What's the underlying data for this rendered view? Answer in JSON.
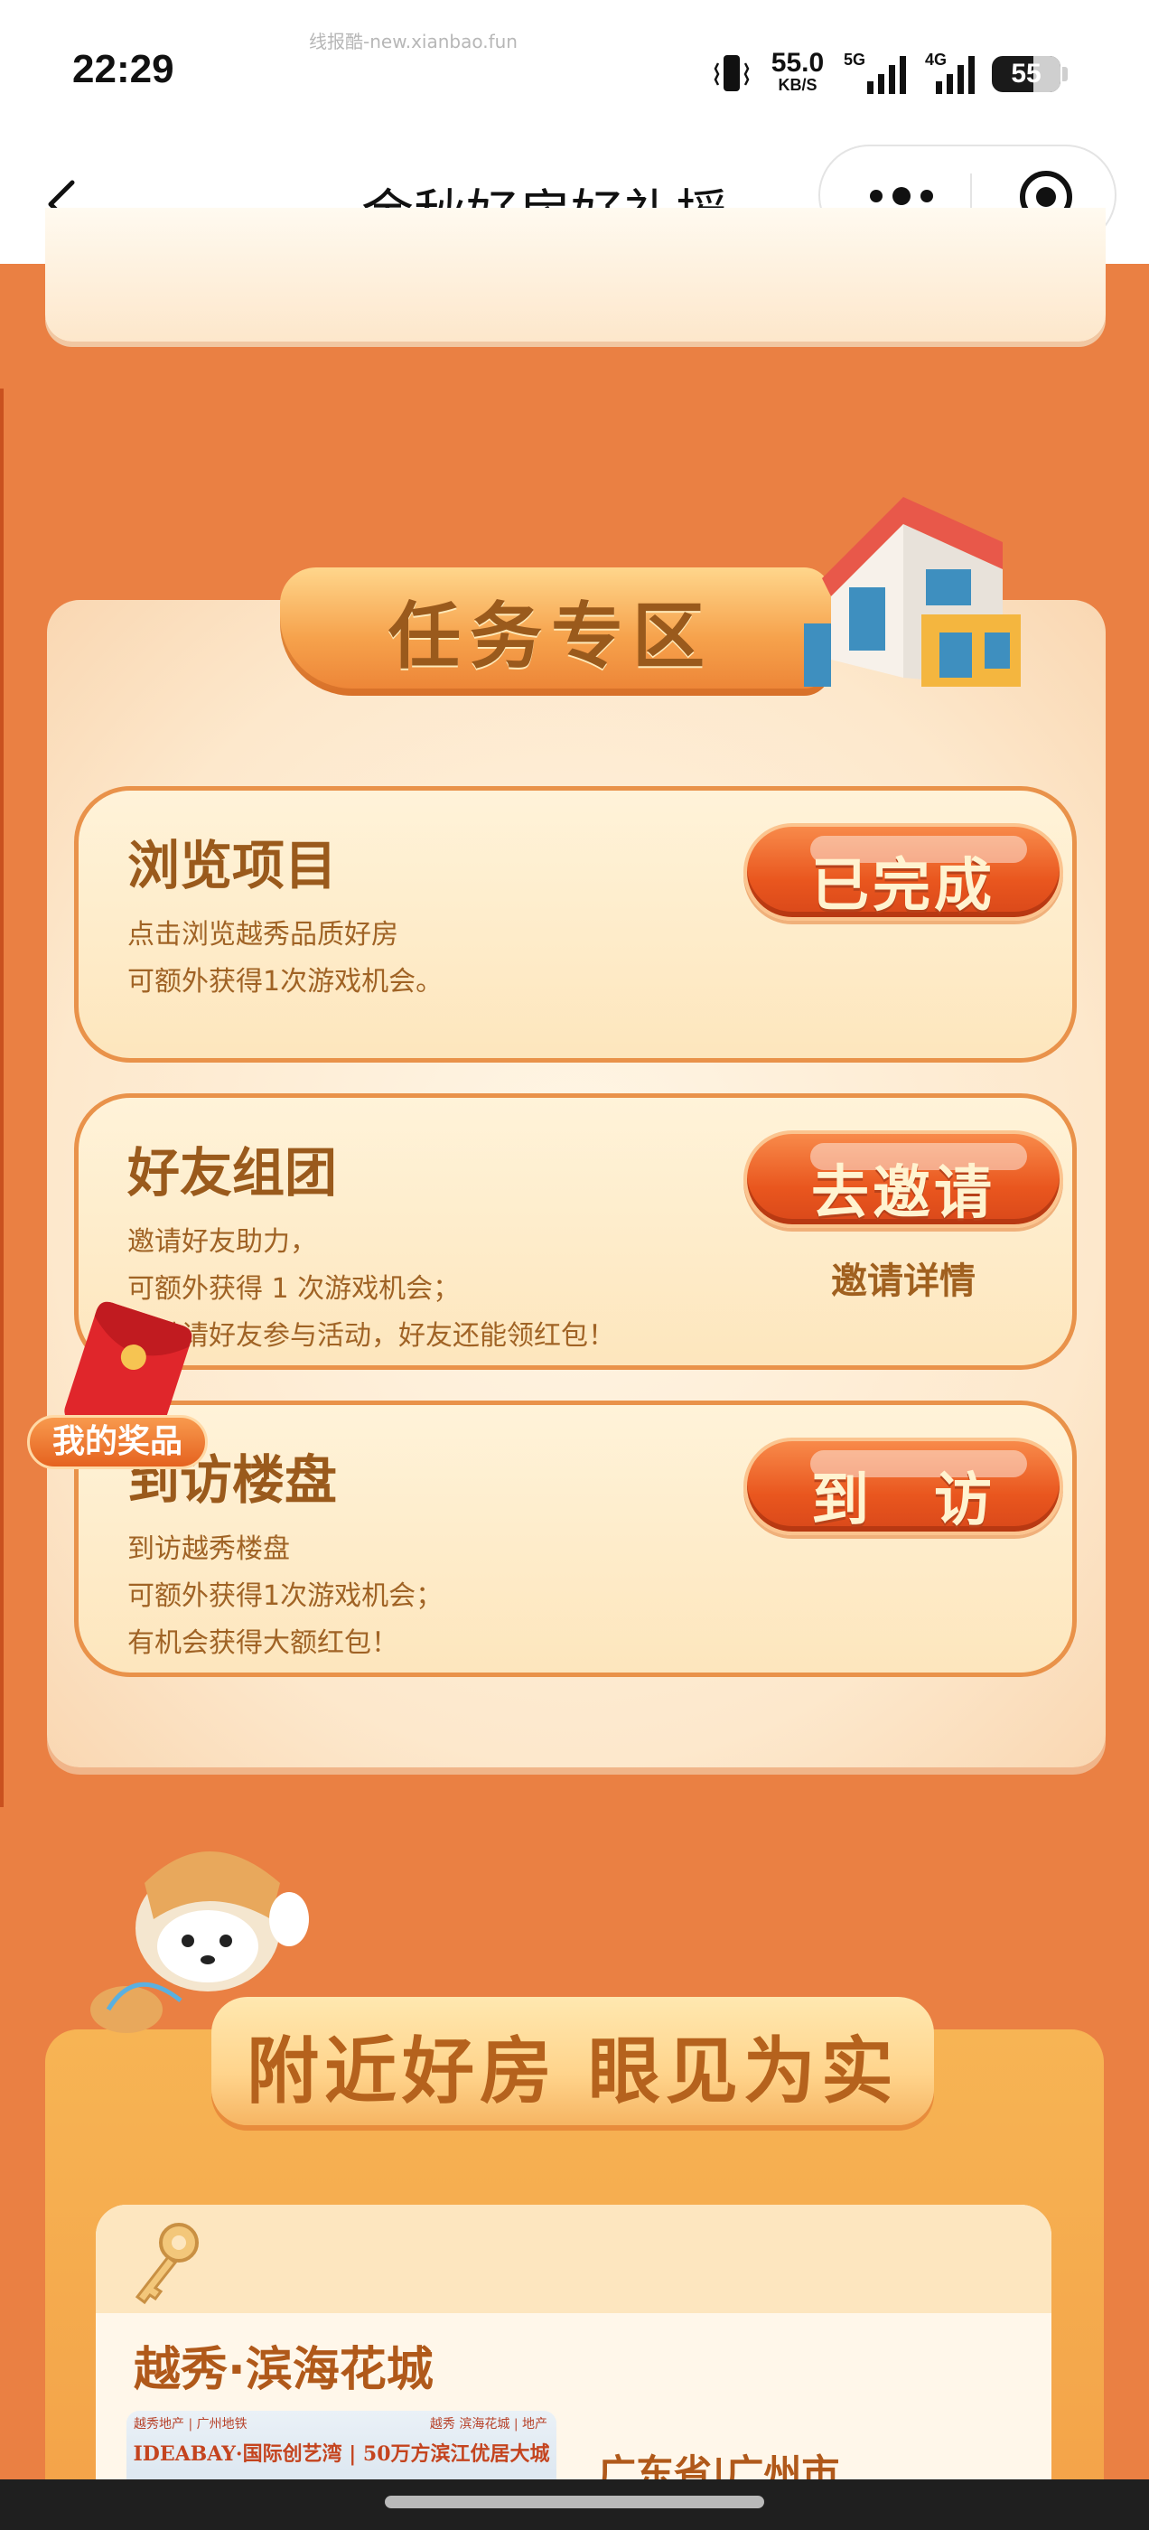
{
  "status_bar": {
    "time": "22:29",
    "watermark": "线报酷-new.xianbao.fun",
    "net_speed_value": "55.0",
    "net_speed_unit": "KB/S",
    "signal_1_tag": "5G",
    "signal_2_tag": "4G",
    "battery": "55",
    "icons": [
      "vibrate-icon",
      "signal-5g-icon",
      "signal-4g-icon",
      "battery-icon"
    ]
  },
  "nav": {
    "title": "金秋好房好礼摇...",
    "icons": [
      "back-icon",
      "more-icon",
      "close-miniprogram-icon"
    ]
  },
  "task_zone": {
    "title": "任务专区",
    "tasks": [
      {
        "title": "浏览项目",
        "lines": [
          "点击浏览越秀品质好房",
          "可额外获得1次游戏机会。"
        ],
        "button": "已完成"
      },
      {
        "title": "好友组团",
        "lines": [
          "邀请好友助力，",
          "可额外获得 1 次游戏机会；",
          "并邀请好友参与活动，好友还能领红包！"
        ],
        "button": "去邀请",
        "detail_link": "邀请详情"
      },
      {
        "title": "到访楼盘",
        "lines": [
          "到访越秀楼盘",
          "可额外获得1次游戏机会；",
          "有机会获得大额红包！"
        ],
        "button": "到　访"
      }
    ]
  },
  "floating_prize": {
    "label": "我的奖品",
    "icon": "red-envelope-icon"
  },
  "nearby": {
    "title": "附近好房 眼见为实",
    "estate": {
      "name": "越秀·滨海花城",
      "location": "广东省|广州市",
      "image_text": "IDEABAY·国际创艺湾 | 50万方滨江优居大城",
      "image_logo_left": "越秀地产 | 广州地铁",
      "image_logo_right": "越秀 滨海花城 | 地产"
    }
  }
}
